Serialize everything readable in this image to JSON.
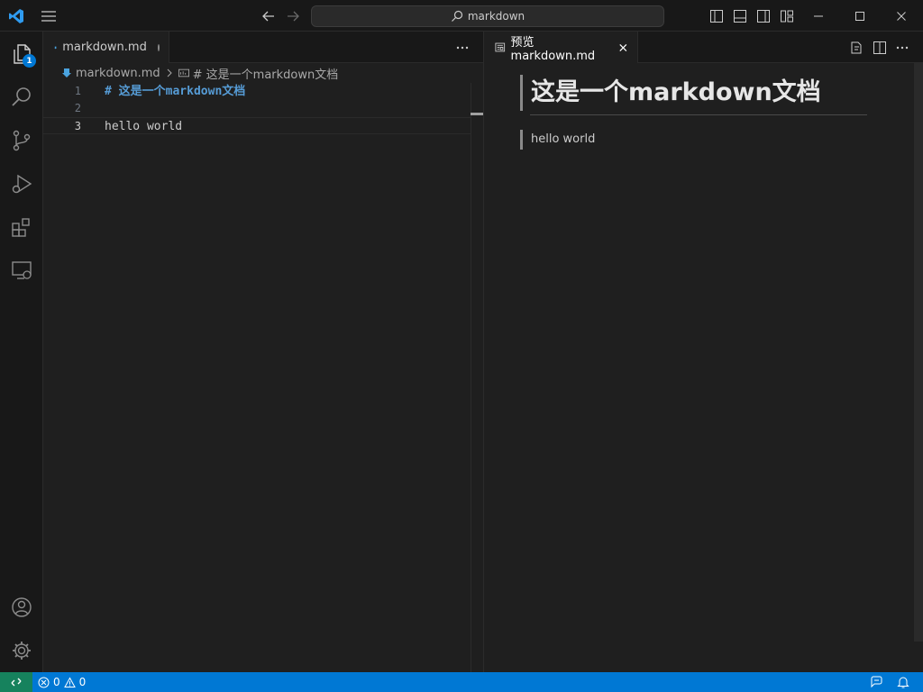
{
  "titlebar": {
    "search_text": "markdown"
  },
  "activitybar": {
    "explorer_badge": "1"
  },
  "editor_left": {
    "tab_label": "markdown.md",
    "breadcrumb_file": "markdown.md",
    "breadcrumb_symbol": "# 这是一个markdown文档",
    "lines": [
      {
        "num": "1",
        "text": "# 这是一个markdown文档"
      },
      {
        "num": "2",
        "text": ""
      },
      {
        "num": "3",
        "text": "hello world"
      }
    ]
  },
  "editor_right": {
    "tab_label": "预览 markdown.md",
    "preview_heading": "这是一个markdown文档",
    "preview_paragraph": "hello world"
  },
  "statusbar": {
    "errors": "0",
    "warnings": "0"
  },
  "colors": {
    "accent": "#0078d4",
    "remote": "#16825d",
    "heading": "#569cd6"
  }
}
